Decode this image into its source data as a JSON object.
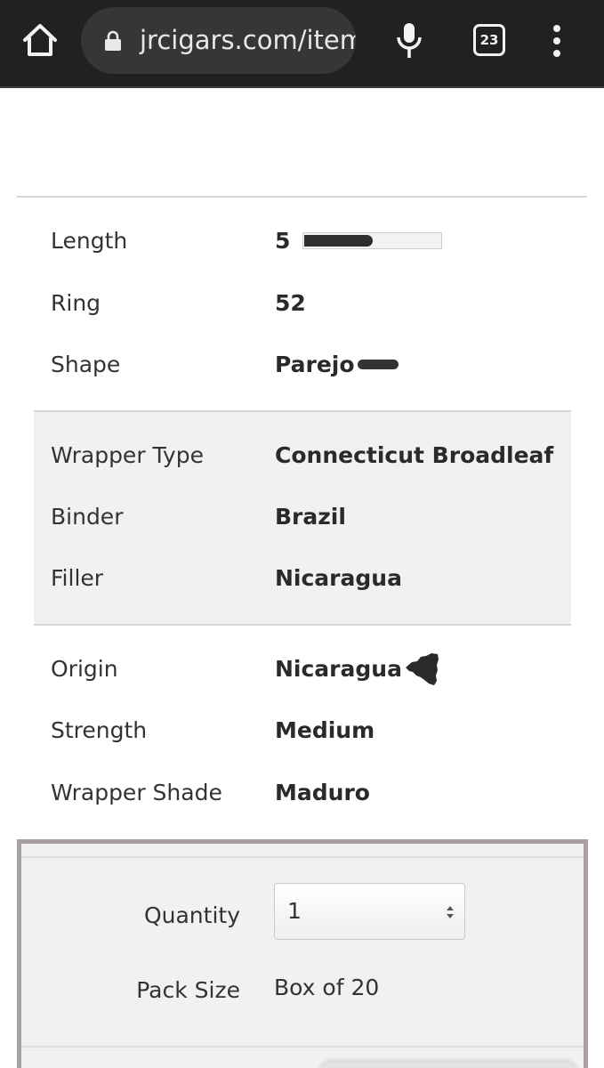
{
  "browser": {
    "url": "jrcigars.com/item",
    "tab_count": "23",
    "icons": {
      "home": "home-icon",
      "lock": "lock-icon",
      "mic": "microphone-icon",
      "tabs": "tab-switcher-icon",
      "menu": "more-vert-icon"
    },
    "colors": {
      "toolbar_bg": "#212121",
      "urlbar_bg": "#363636"
    }
  },
  "specs": {
    "length": {
      "label": "Length",
      "value": "5",
      "bar_fraction": 0.5
    },
    "ring": {
      "label": "Ring",
      "value": "52"
    },
    "shape": {
      "label": "Shape",
      "value": "Parejo"
    },
    "wrapper_type": {
      "label": "Wrapper Type",
      "value": "Connecticut Broadleaf"
    },
    "binder": {
      "label": "Binder",
      "value": "Brazil"
    },
    "filler": {
      "label": "Filler",
      "value": "Nicaragua"
    },
    "origin": {
      "label": "Origin",
      "value": "Nicaragua",
      "icon": "nicaragua-map-icon"
    },
    "strength": {
      "label": "Strength",
      "value": "Medium"
    },
    "wrapper_shade": {
      "label": "Wrapper Shade",
      "value": "Maduro"
    }
  },
  "purchase": {
    "quantity_label": "Quantity",
    "quantity_value": "1",
    "pack_size_label": "Pack Size",
    "pack_size_value": "Box of 20",
    "panel_border_color": "#a89f9f"
  }
}
